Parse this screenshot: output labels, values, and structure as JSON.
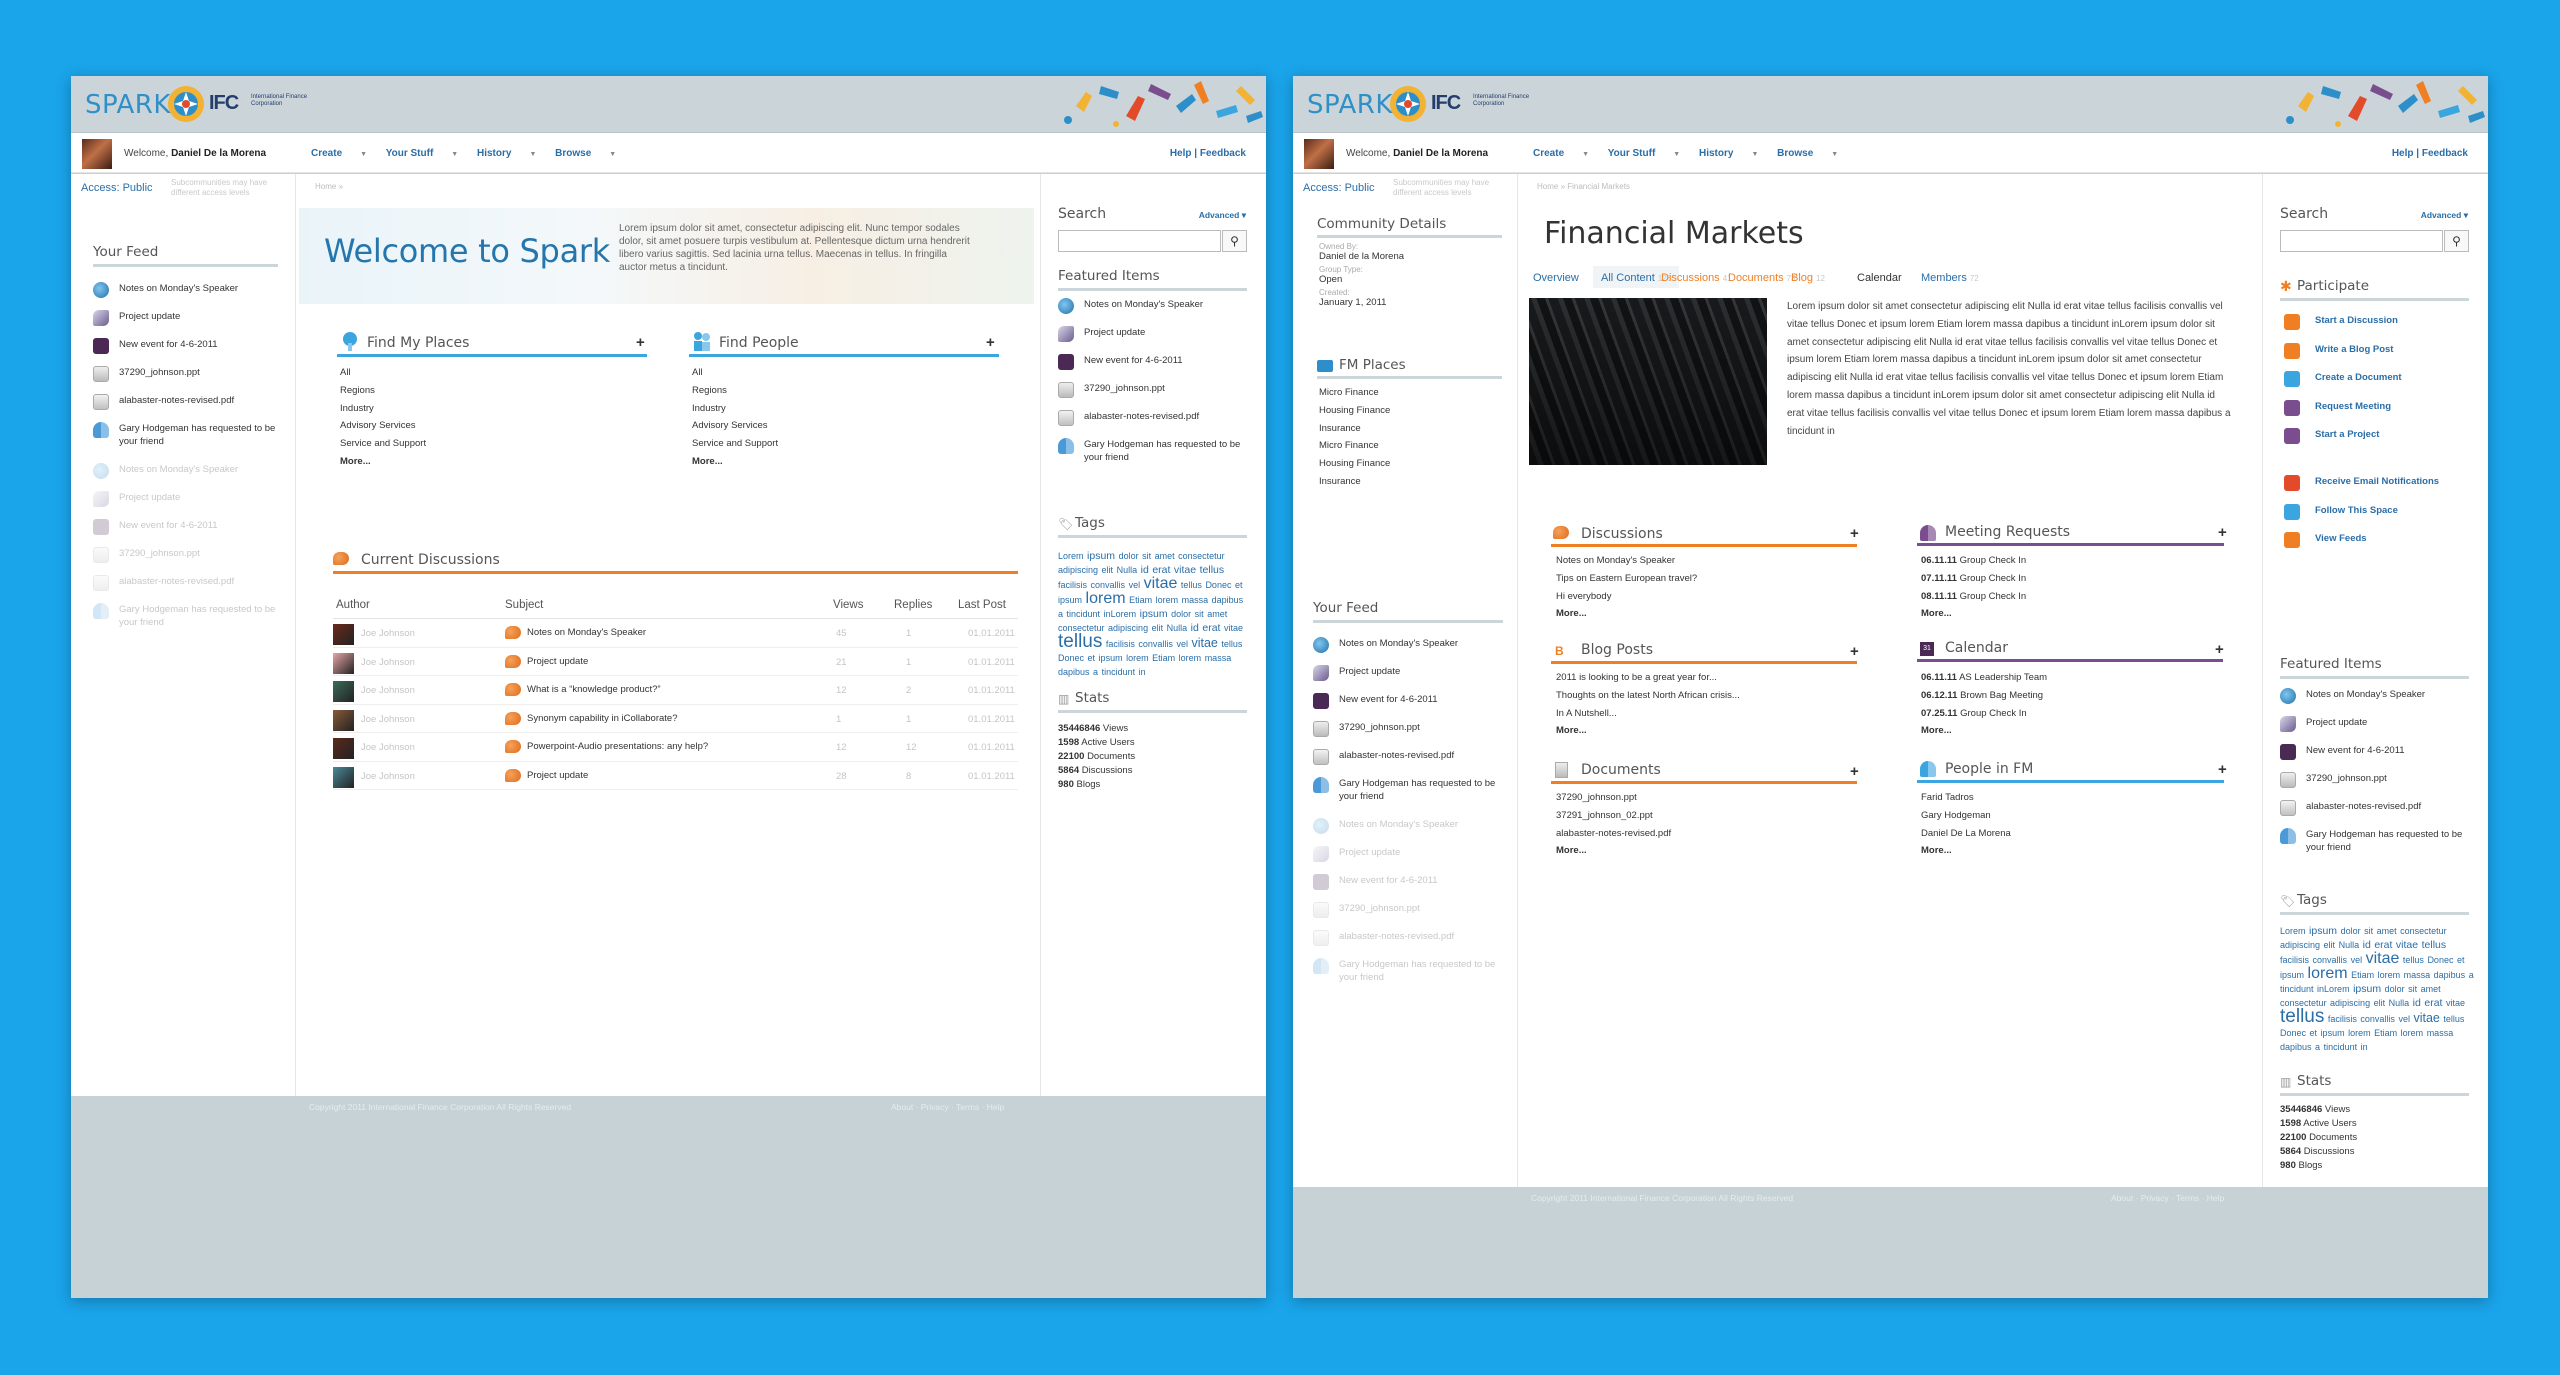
{
  "brand": {
    "name": "SPARK",
    "ifc": "IFC",
    "ifc_sub": "International Finance Corporation"
  },
  "nav": {
    "welcome_prefix": "Welcome,",
    "create": "Create",
    "your_stuff": "Your Stuff",
    "history": "History",
    "browse": "Browse",
    "help_feedback": "Help | Feedback"
  },
  "footer": {
    "copyright": "Copyright 2011 International Finance Corporation All Rights Reserved",
    "links": "About · Privacy · Terms · Help"
  },
  "colors": {
    "background": "#1aa4ea",
    "accent_blue": "#3aa5df",
    "accent_orange": "#f07f23",
    "accent_purple": "#7a4e8e",
    "link": "#2a6ea8"
  },
  "left_panel": {
    "user": "Daniel De la Morena",
    "access": "Access: Public",
    "access_note": "Subcommunities may have different access levels",
    "breadcrumb": "Home »",
    "feed_title": "Your Feed",
    "feed": [
      {
        "icon": "speaker-icon",
        "text": "Notes on Monday's Speaker",
        "dim": false
      },
      {
        "icon": "project-icon",
        "text": "Project update",
        "dim": false
      },
      {
        "icon": "calendar-icon",
        "text": "New event for 4-6-2011",
        "dim": false
      },
      {
        "icon": "ppt-icon",
        "text": "37290_johnson.ppt",
        "dim": false
      },
      {
        "icon": "pdf-icon",
        "text": "alabaster-notes-revised.pdf",
        "dim": false
      },
      {
        "icon": "people-icon",
        "text": "Gary Hodgeman has requested to be your friend",
        "dim": false
      },
      {
        "icon": "speaker-icon",
        "text": "Notes on Monday's Speaker",
        "dim": true
      },
      {
        "icon": "project-icon",
        "text": "Project update",
        "dim": true
      },
      {
        "icon": "calendar-icon",
        "text": "New event for 4-6-2011",
        "dim": true
      },
      {
        "icon": "ppt-icon",
        "text": "37290_johnson.ppt",
        "dim": true
      },
      {
        "icon": "pdf-icon",
        "text": "alabaster-notes-revised.pdf",
        "dim": true
      },
      {
        "icon": "people-icon",
        "text": "Gary Hodgeman has requested to be your friend",
        "dim": true
      }
    ],
    "hero_title": "Welcome to Spark",
    "hero_text": "Lorem ipsum dolor sit amet, consectetur adipiscing elit. Nunc tempor sodales dolor, sit amet posuere turpis vestibulum at. Pellentesque dictum urna hendrerit libero varius sagittis. Sed lacinia urna tellus. Maecenas in tellus. In fringilla auctor metus a tincidunt.",
    "find_places": {
      "title": "Find My Places",
      "plus": "+",
      "items": [
        "All",
        "Regions",
        "Industry",
        "Advisory Services",
        "Service and Support"
      ],
      "more": "More..."
    },
    "find_people": {
      "title": "Find People",
      "plus": "+",
      "items": [
        "All",
        "Regions",
        "Industry",
        "Advisory Services",
        "Service and Support"
      ],
      "more": "More..."
    },
    "discussions_title": "Current Discussions",
    "discussion_headers": {
      "author": "Author",
      "subject": "Subject",
      "views": "Views",
      "replies": "Replies",
      "last_post": "Last Post"
    },
    "discussions": [
      {
        "author": "Joe Johnson",
        "subject": "Notes on Monday's Speaker",
        "views": "45",
        "replies": "1",
        "last": "01.01.2011"
      },
      {
        "author": "Joe Johnson",
        "subject": "Project update",
        "views": "21",
        "replies": "1",
        "last": "01.01.2011"
      },
      {
        "author": "Joe Johnson",
        "subject": "What is a “knowledge product?”",
        "views": "12",
        "replies": "2",
        "last": "01.01.2011"
      },
      {
        "author": "Joe Johnson",
        "subject": "Synonym capability in iCollaborate?",
        "views": "1",
        "replies": "1",
        "last": "01.01.2011"
      },
      {
        "author": "Joe Johnson",
        "subject": "Powerpoint-Audio presentations: any help?",
        "views": "12",
        "replies": "12",
        "last": "01.01.2011"
      },
      {
        "author": "Joe Johnson",
        "subject": "Project update",
        "views": "28",
        "replies": "8",
        "last": "01.01.2011"
      }
    ],
    "search_label": "Search",
    "advanced": "Advanced",
    "featured_title": "Featured Items",
    "featured": [
      {
        "icon": "speaker-icon",
        "text": "Notes on Monday's Speaker"
      },
      {
        "icon": "project-icon",
        "text": "Project update"
      },
      {
        "icon": "calendar-icon",
        "text": "New event for 4-6-2011"
      },
      {
        "icon": "ppt-icon",
        "text": "37290_johnson.ppt"
      },
      {
        "icon": "pdf-icon",
        "text": "alabaster-notes-revised.pdf"
      },
      {
        "icon": "people-icon",
        "text": "Gary Hodgeman has requested to be your friend"
      }
    ],
    "tags_title": "Tags",
    "stats_title": "Stats",
    "stats": [
      {
        "num": "35446846",
        "label": "Views"
      },
      {
        "num": "1598",
        "label": "Active Users"
      },
      {
        "num": "22100",
        "label": "Documents"
      },
      {
        "num": "5864",
        "label": "Discussions"
      },
      {
        "num": "980",
        "label": "Blogs"
      }
    ]
  },
  "right_panel": {
    "user": "Daniel De la Morena",
    "access": "Access: Public",
    "access_note": "Subcommunities may have different access levels",
    "breadcrumb": "Home » Financial Markets",
    "community_title": "Community Details",
    "owned_by_label": "Owned By:",
    "owned_by": "Daniel de la Morena",
    "group_type_label": "Group Type:",
    "group_type": "Open",
    "created_label": "Created:",
    "created": "January 1, 2011",
    "fm_places_title": "FM Places",
    "fm_places": [
      "Micro Finance",
      "Housing Finance",
      "Insurance",
      "Micro Finance",
      "Housing Finance",
      "Insurance"
    ],
    "page_title": "Financial Markets",
    "tabs": [
      {
        "label": "Overview",
        "count": "",
        "style": "blue"
      },
      {
        "label": "All Content",
        "count": "126",
        "style": "sel"
      },
      {
        "label": "Discussions",
        "count": "41",
        "style": "orange"
      },
      {
        "label": "Documents",
        "count": "73",
        "style": "orange"
      },
      {
        "label": "Blog",
        "count": "12",
        "style": "orange"
      },
      {
        "label": "Calendar",
        "count": "",
        "style": "plain"
      },
      {
        "label": "Members",
        "count": "72",
        "style": "blue"
      }
    ],
    "intro_text": "Lorem ipsum dolor sit amet consectetur adipiscing elit Nulla id erat vitae tellus facilisis convallis vel vitae tellus Donec et ipsum lorem Etiam lorem massa dapibus a tincidunt inLorem ipsum dolor sit amet consectetur adipiscing elit Nulla id erat vitae tellus facilisis convallis vel vitae tellus Donec et ipsum lorem Etiam lorem massa dapibus a tincidunt inLorem ipsum dolor sit amet consectetur adipiscing elit Nulla id erat vitae tellus facilisis convallis vel vitae tellus Donec et ipsum lorem Etiam lorem massa dapibus a tincidunt inLorem ipsum dolor sit amet consectetur adipiscing elit Nulla id erat vitae tellus facilisis convallis vel vitae tellus Donec et ipsum lorem Etiam lorem massa dapibus a tincidunt in",
    "discussions": {
      "title": "Discussions",
      "plus": "+",
      "items": [
        "Notes on Monday's Speaker",
        "Tips on Eastern European travel?",
        "Hi everybody"
      ],
      "more": "More..."
    },
    "blog": {
      "title": "Blog Posts",
      "plus": "+",
      "items": [
        "2011 is looking to be a great year for...",
        "Thoughts on the latest North African crisis...",
        "In A Nutshell..."
      ],
      "more": "More..."
    },
    "documents": {
      "title": "Documents",
      "plus": "+",
      "items": [
        "37290_johnson.ppt",
        "37291_johnson_02.ppt",
        "alabaster-notes-revised.pdf"
      ],
      "more": "More..."
    },
    "meetings": {
      "title": "Meeting Requests",
      "plus": "+",
      "items": [
        {
          "date": "06.11.11",
          "text": "Group Check In"
        },
        {
          "date": "07.11.11",
          "text": "Group Check In"
        },
        {
          "date": "08.11.11",
          "text": "Group Check In"
        }
      ],
      "more": "More..."
    },
    "calendar": {
      "title": "Calendar",
      "plus": "+",
      "items": [
        {
          "date": "06.11.11",
          "text": "AS Leadership Team"
        },
        {
          "date": "06.12.11",
          "text": "Brown Bag Meeting"
        },
        {
          "date": "07.25.11",
          "text": "Group Check In"
        }
      ],
      "more": "More..."
    },
    "people": {
      "title": "People in FM",
      "plus": "+",
      "items": [
        "Farid Tadros",
        "Gary Hodgeman",
        "Daniel De La Morena"
      ],
      "more": "More..."
    },
    "feed_title": "Your Feed",
    "feed": [
      {
        "icon": "speaker-icon",
        "text": "Notes on Monday's Speaker",
        "dim": false
      },
      {
        "icon": "project-icon",
        "text": "Project update",
        "dim": false
      },
      {
        "icon": "calendar-icon",
        "text": "New event for 4-6-2011",
        "dim": false
      },
      {
        "icon": "ppt-icon",
        "text": "37290_johnson.ppt",
        "dim": false
      },
      {
        "icon": "pdf-icon",
        "text": "alabaster-notes-revised.pdf",
        "dim": false
      },
      {
        "icon": "people-icon",
        "text": "Gary Hodgeman has requested to be your friend",
        "dim": false
      },
      {
        "icon": "speaker-icon",
        "text": "Notes on Monday's Speaker",
        "dim": true
      },
      {
        "icon": "project-icon",
        "text": "Project update",
        "dim": true
      },
      {
        "icon": "calendar-icon",
        "text": "New event for 4-6-2011",
        "dim": true
      },
      {
        "icon": "ppt-icon",
        "text": "37290_johnson.ppt",
        "dim": true
      },
      {
        "icon": "pdf-icon",
        "text": "alabaster-notes-revised.pdf",
        "dim": true
      },
      {
        "icon": "people-icon",
        "text": "Gary Hodgeman has requested to be your friend",
        "dim": true
      }
    ],
    "search_label": "Search",
    "advanced": "Advanced",
    "participate_title": "Participate",
    "participate": [
      "Start a Discussion",
      "Write a Blog Post",
      "Create a Document",
      "Request Meeting",
      "Start a Project"
    ],
    "actions": [
      "Receive Email Notifications",
      "Follow This Space",
      "View Feeds"
    ],
    "featured_title": "Featured Items",
    "featured": [
      {
        "icon": "speaker-icon",
        "text": "Notes on Monday's Speaker"
      },
      {
        "icon": "project-icon",
        "text": "Project update"
      },
      {
        "icon": "calendar-icon",
        "text": "New event for 4-6-2011"
      },
      {
        "icon": "ppt-icon",
        "text": "37290_johnson.ppt"
      },
      {
        "icon": "pdf-icon",
        "text": "alabaster-notes-revised.pdf"
      },
      {
        "icon": "people-icon",
        "text": "Gary Hodgeman has requested to be your friend"
      }
    ],
    "tags_title": "Tags",
    "stats_title": "Stats",
    "stats": [
      {
        "num": "35446846",
        "label": "Views"
      },
      {
        "num": "1598",
        "label": "Active Users"
      },
      {
        "num": "22100",
        "label": "Documents"
      },
      {
        "num": "5864",
        "label": "Discussions"
      },
      {
        "num": "980",
        "label": "Blogs"
      }
    ]
  },
  "tag_cloud": [
    {
      "t": "Lorem",
      "s": 0
    },
    {
      "t": "ipsum",
      "s": 1
    },
    {
      "t": "dolor",
      "s": 0
    },
    {
      "t": "sit",
      "s": 0
    },
    {
      "t": "amet",
      "s": 0
    },
    {
      "t": "consectetur",
      "s": 0
    },
    {
      "t": "adipiscing",
      "s": 0
    },
    {
      "t": "elit",
      "s": 0
    },
    {
      "t": "Nulla",
      "s": 0
    },
    {
      "t": "id",
      "s": 1
    },
    {
      "t": "erat",
      "s": 1
    },
    {
      "t": "vitae",
      "s": 1
    },
    {
      "t": "tellus",
      "s": 1
    },
    {
      "t": "facilisis",
      "s": 0
    },
    {
      "t": "convallis",
      "s": 0
    },
    {
      "t": "vel",
      "s": 0
    },
    {
      "t": "vitae",
      "s": 3
    },
    {
      "t": "tellus",
      "s": 0
    },
    {
      "t": "Donec",
      "s": 0
    },
    {
      "t": "et",
      "s": 0
    },
    {
      "t": "ipsum",
      "s": 0
    },
    {
      "t": "lorem",
      "s": 3
    },
    {
      "t": "Etiam",
      "s": 0
    },
    {
      "t": "lorem",
      "s": 0
    },
    {
      "t": "massa",
      "s": 0
    },
    {
      "t": "dapibus",
      "s": 0
    },
    {
      "t": "a",
      "s": 0
    },
    {
      "t": "tincidunt",
      "s": 0
    },
    {
      "t": "inLorem",
      "s": 0
    },
    {
      "t": "ipsum",
      "s": 1
    },
    {
      "t": "dolor",
      "s": 0
    },
    {
      "t": "sit",
      "s": 0
    },
    {
      "t": "amet",
      "s": 0
    },
    {
      "t": "consectetur",
      "s": 0
    },
    {
      "t": "adipiscing",
      "s": 0
    },
    {
      "t": "elit",
      "s": 0
    },
    {
      "t": "Nulla",
      "s": 0
    },
    {
      "t": "id",
      "s": 1
    },
    {
      "t": "erat",
      "s": 1
    },
    {
      "t": "vitae",
      "s": 0
    },
    {
      "t": "tellus",
      "s": 4
    },
    {
      "t": "facilisis",
      "s": 0
    },
    {
      "t": "convallis",
      "s": 0
    },
    {
      "t": "vel",
      "s": 0
    },
    {
      "t": "vitae",
      "s": 2
    },
    {
      "t": "tellus",
      "s": 0
    },
    {
      "t": "Donec",
      "s": 0
    },
    {
      "t": "et",
      "s": 0
    },
    {
      "t": "ipsum",
      "s": 0
    },
    {
      "t": "lorem",
      "s": 0
    },
    {
      "t": "Etiam",
      "s": 0
    },
    {
      "t": "lorem",
      "s": 0
    },
    {
      "t": "massa",
      "s": 0
    },
    {
      "t": "dapibus",
      "s": 0
    },
    {
      "t": "a",
      "s": 0
    },
    {
      "t": "tincidunt",
      "s": 0
    },
    {
      "t": "in",
      "s": 0
    }
  ]
}
